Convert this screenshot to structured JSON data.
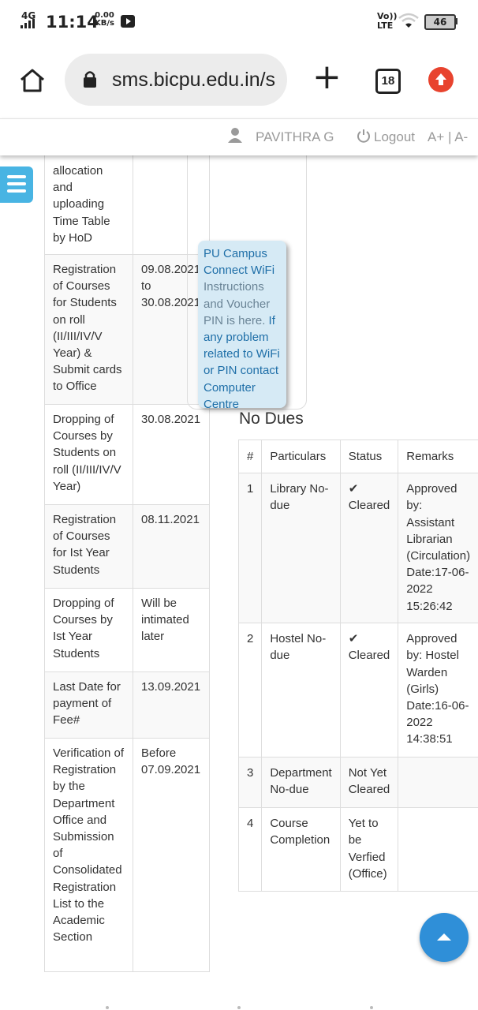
{
  "status_bar": {
    "network": "4G",
    "time": "11:14",
    "speed_value": "0.00",
    "speed_unit": "KB/s",
    "volte": "Vo))",
    "lte": "LTE",
    "battery": "46"
  },
  "browser": {
    "url": "sms.bicpu.edu.in/s",
    "tab_count": "18",
    "new_tab_label": "+"
  },
  "site_header": {
    "user_name": "PAVITHRA G",
    "logout_label": "Logout",
    "font_size_controls": "A+ | A-"
  },
  "schedule": {
    "rows": [
      {
        "event": "allocation and uploading Time Table by HoD",
        "date": ""
      },
      {
        "event": "Registration of Courses for Students on roll (II/III/IV/V Year) & Submit cards to Office",
        "date": "09.08.2021 to 30.08.2021"
      },
      {
        "event": "Dropping of Courses by Students on roll (II/III/IV/V Year)",
        "date": "30.08.2021"
      },
      {
        "event": "Registration of Courses for Ist Year Students",
        "date": "08.11.2021"
      },
      {
        "event": "Dropping of Courses by Ist Year Students",
        "date": "Will be intimated later"
      },
      {
        "event": "Last Date for payment of Fee#",
        "date": "13.09.2021"
      },
      {
        "event": "Verification of Registration by the Department Office and Submission of Consolidated Registration List to the Academic Section",
        "date": "Before 07.09.2021"
      }
    ]
  },
  "wifi_notice": {
    "title": "PU Campus Connect WiFi",
    "body": "Instructions and Voucher PIN is here.",
    "contact": "If any problem related to WiFi or PIN contact Computer Centre"
  },
  "dues": {
    "title": "No Dues",
    "headers": [
      "#",
      "Particulars",
      "Status",
      "Remarks"
    ],
    "rows": [
      {
        "num": "1",
        "particular": "Library No-due",
        "status": "Cleared",
        "check": true,
        "remarks": "Approved by: Assistant Librarian (Circulation) Date:17-06-2022 15:26:42"
      },
      {
        "num": "2",
        "particular": "Hostel No-due",
        "status": "Cleared",
        "check": true,
        "remarks": "Approved by: Hostel Warden (Girls) Date:16-06-2022 14:38:51"
      },
      {
        "num": "3",
        "particular": "Department No-due",
        "status": "Not Yet Cleared",
        "check": false,
        "remarks": ""
      },
      {
        "num": "4",
        "particular": "Course Completion",
        "status": "Yet to be Verfied (Office)",
        "check": false,
        "remarks": ""
      }
    ]
  },
  "colors": {
    "menu_button": "#48b4e3",
    "scroll_top_button": "#2f8fd8",
    "upload_badge": "#e8432e",
    "popup_bg": "#d6eaf5",
    "popup_link": "#1f6fa8"
  },
  "icons": [
    "home-icon",
    "lock-icon",
    "plus-icon",
    "tabs-icon",
    "upload-icon",
    "user-icon",
    "power-icon",
    "menu-icon",
    "chevron-up-icon",
    "checkmark-icon"
  ]
}
